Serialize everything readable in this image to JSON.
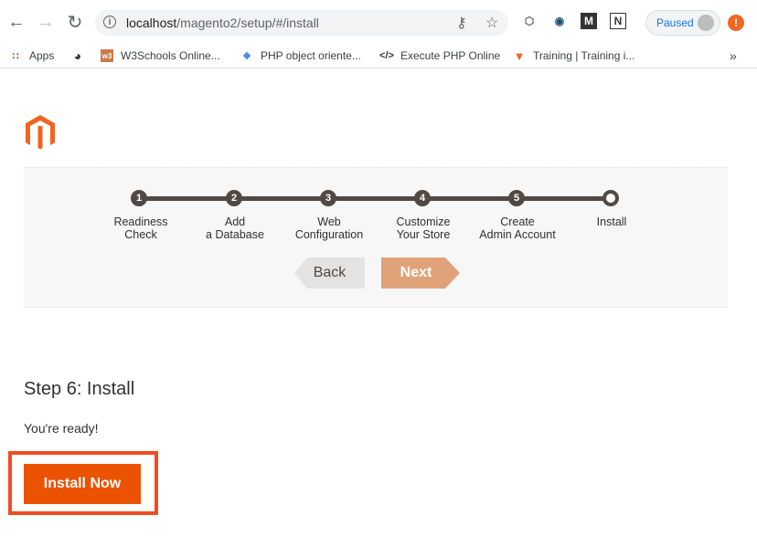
{
  "browser": {
    "url_host": "localhost",
    "url_path": "/magento2/setup/#/install",
    "paused_label": "Paused",
    "update_badge": "!",
    "extensions": [
      "M",
      "N"
    ]
  },
  "bookmarks": [
    {
      "label": "Apps",
      "icon": "apps-grid-icon"
    },
    {
      "label": "",
      "icon": "globe-icon"
    },
    {
      "label": "W3Schools Online...",
      "icon": "w3schools-icon"
    },
    {
      "label": "PHP object oriente...",
      "icon": "php-icon"
    },
    {
      "label": "Execute PHP Online",
      "icon": "code-icon"
    },
    {
      "label": "Training | Training i...",
      "icon": "training-icon"
    }
  ],
  "bookmarks_more": "»",
  "progress": {
    "steps": [
      {
        "number": "1",
        "label_line1": "Readiness",
        "label_line2": "Check"
      },
      {
        "number": "2",
        "label_line1": "Add",
        "label_line2": "a Database"
      },
      {
        "number": "3",
        "label_line1": "Web",
        "label_line2": "Configuration"
      },
      {
        "number": "4",
        "label_line1": "Customize",
        "label_line2": "Your Store"
      },
      {
        "number": "5",
        "label_line1": "Create",
        "label_line2": "Admin Account"
      },
      {
        "number": "",
        "label_line1": "Install",
        "label_line2": ""
      }
    ],
    "back_label": "Back",
    "next_label": "Next"
  },
  "main": {
    "title": "Step 6: Install",
    "message": "You're ready!",
    "install_button": "Install Now"
  },
  "colors": {
    "brand_orange": "#eb5202",
    "highlight": "#ef4c23",
    "next_disabled": "#e0a379",
    "track": "#514943"
  }
}
